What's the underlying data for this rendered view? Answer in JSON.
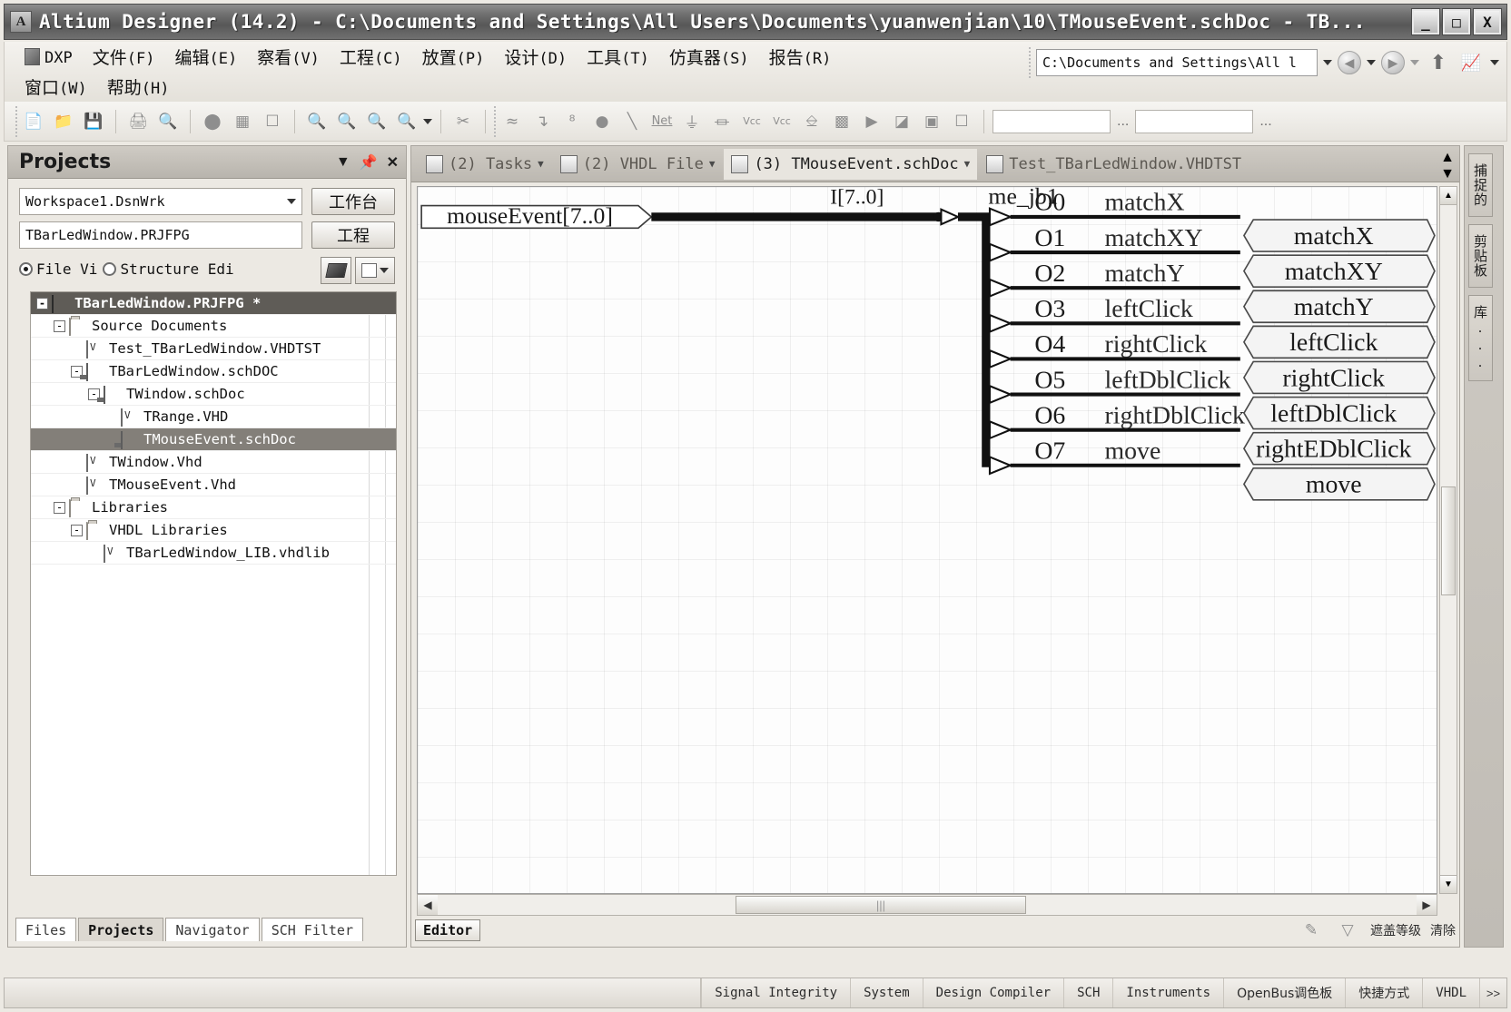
{
  "window": {
    "title": "Altium Designer (14.2) - C:\\Documents and Settings\\All Users\\Documents\\yuanwenjian\\10\\TMouseEvent.schDoc - TB...",
    "app_icon": "A",
    "minimize": "_",
    "maximize": "□",
    "close": "X"
  },
  "menu": {
    "dxp": "DXP",
    "items": [
      {
        "label": "文件",
        "mnemonic": "(F)"
      },
      {
        "label": "编辑",
        "mnemonic": "(E)"
      },
      {
        "label": "察看",
        "mnemonic": "(V)"
      },
      {
        "label": "工程",
        "mnemonic": "(C)"
      },
      {
        "label": "放置",
        "mnemonic": "(P)"
      },
      {
        "label": "设计",
        "mnemonic": "(D)"
      },
      {
        "label": "工具",
        "mnemonic": "(T)"
      },
      {
        "label": "仿真器",
        "mnemonic": "(S)"
      },
      {
        "label": "报告",
        "mnemonic": "(R)"
      },
      {
        "label": "窗口",
        "mnemonic": "(W)"
      },
      {
        "label": "帮助",
        "mnemonic": "(H)"
      }
    ],
    "address_value": "C:\\Documents and Settings\\All l"
  },
  "toolbar": {
    "group1": [
      "new-document-icon",
      "open-folder-icon",
      "save-icon"
    ],
    "group2": [
      "print-icon",
      "print-preview-icon"
    ],
    "group3": [
      "board-icon",
      "component-icon",
      "window-icon"
    ],
    "group4": [
      "zoom-document-icon",
      "zoom-area-icon",
      "zoom-select-icon",
      "zoom-filter-icon"
    ],
    "group5": [
      "cut-icon"
    ],
    "group6": [
      "wire-icon",
      "bus-icon",
      "bus-entry-icon",
      "net-point-icon",
      "line-icon",
      "net-label-icon",
      "gnd-power-icon",
      "gnd-icon",
      "vcc-power-icon",
      "vcc-bar-icon",
      "part-icon",
      "sheet-symbol-icon",
      "sheet-entry-icon",
      "port-icon",
      "device-sheet-icon",
      "no-erc-icon"
    ],
    "combo1": "",
    "combo2": "",
    "dots": "..."
  },
  "projects_panel": {
    "title": "Projects",
    "header_buttons": [
      "dropdown-icon",
      "pin-icon",
      "close-icon"
    ],
    "workspace_value": "Workspace1.DsnWrk",
    "workspace_button": "工作台",
    "project_value": "TBarLedWindow.PRJFPG",
    "project_button": "工程",
    "view_mode": {
      "file_view_label": "File Vi",
      "structure_edit_label": "Structure Edi",
      "selected": "file_view"
    },
    "tree": [
      {
        "label": "TBarLedWindow.PRJFPG *",
        "indent": 0,
        "icon": "project-icon",
        "expander": "-",
        "state": "selected-dark"
      },
      {
        "label": "Source Documents",
        "indent": 1,
        "icon": "folder-icon",
        "expander": "-",
        "state": ""
      },
      {
        "label": "Test_TBarLedWindow.VHDTST",
        "indent": 2,
        "icon": "vhdl-test-icon",
        "expander": "",
        "state": ""
      },
      {
        "label": "TBarLedWindow.schDOC",
        "indent": 2,
        "icon": "schematic-icon",
        "expander": "-",
        "state": ""
      },
      {
        "label": "TWindow.schDoc",
        "indent": 3,
        "icon": "schematic-icon",
        "expander": "-",
        "state": ""
      },
      {
        "label": "TRange.VHD",
        "indent": 4,
        "icon": "vhdl-file-icon",
        "expander": "",
        "state": ""
      },
      {
        "label": "TMouseEvent.schDoc",
        "indent": 4,
        "icon": "schematic-icon",
        "expander": "",
        "state": "selected-grey"
      },
      {
        "label": "TWindow.Vhd",
        "indent": 2,
        "icon": "vhdl-file-icon",
        "expander": "",
        "state": ""
      },
      {
        "label": "TMouseEvent.Vhd",
        "indent": 2,
        "icon": "vhdl-file-icon",
        "expander": "",
        "state": ""
      },
      {
        "label": "Libraries",
        "indent": 1,
        "icon": "folder-icon",
        "expander": "-",
        "state": ""
      },
      {
        "label": "VHDL Libraries",
        "indent": 2,
        "icon": "folder-icon",
        "expander": "-",
        "state": ""
      },
      {
        "label": "TBarLedWindow_LIB.vhdlib",
        "indent": 3,
        "icon": "vhdl-lib-icon",
        "expander": "",
        "state": ""
      }
    ],
    "bottom_tabs": [
      {
        "label": "Files",
        "active": false
      },
      {
        "label": "Projects",
        "active": true
      },
      {
        "label": "Navigator",
        "active": false
      },
      {
        "label": "SCH Filter",
        "active": false
      }
    ]
  },
  "editor": {
    "doc_tabs": [
      {
        "label": "(2) Tasks",
        "icon": "tasks-icon",
        "caret": true,
        "active": false
      },
      {
        "label": "(2) VHDL File",
        "icon": "vhdl-file-icon",
        "caret": true,
        "active": false
      },
      {
        "label": "(3) TMouseEvent.schDoc",
        "icon": "schematic-icon",
        "caret": true,
        "active": true
      },
      {
        "label": "Test_TBarLedWindow.VHDTST",
        "icon": "vhdl-test-icon",
        "caret": false,
        "active": false
      }
    ],
    "status_button": "Editor",
    "status_right": [
      "mask-level-icon",
      "filter-icon",
      "遮盖等级",
      "清除"
    ]
  },
  "schematic": {
    "input_port": "mouseEvent[7..0]",
    "bus_label": "I[7..0]",
    "sheet_symbol_label": "me_jb1",
    "pins": [
      {
        "id": "O0",
        "net": "matchX"
      },
      {
        "id": "O1",
        "net": "matchXY"
      },
      {
        "id": "O2",
        "net": "matchY"
      },
      {
        "id": "O3",
        "net": "leftClick"
      },
      {
        "id": "O4",
        "net": "rightClick"
      },
      {
        "id": "O5",
        "net": "leftDblClick"
      },
      {
        "id": "O6",
        "net": "rightDblClick"
      },
      {
        "id": "O7",
        "net": "move"
      }
    ],
    "output_ports": [
      "matchX",
      "matchXY",
      "matchY",
      "leftClick",
      "rightClick",
      "leftDblClick",
      "rightEDblClick",
      "move"
    ]
  },
  "right_dock": {
    "tabs": [
      "捕捉的",
      "剪贴板",
      "库..."
    ]
  },
  "statusbar": {
    "items": [
      "Signal Integrity",
      "System",
      "Design Compiler",
      "SCH",
      "Instruments",
      "OpenBus调色板",
      "快捷方式",
      "VHDL"
    ],
    "overflow": ">>"
  }
}
